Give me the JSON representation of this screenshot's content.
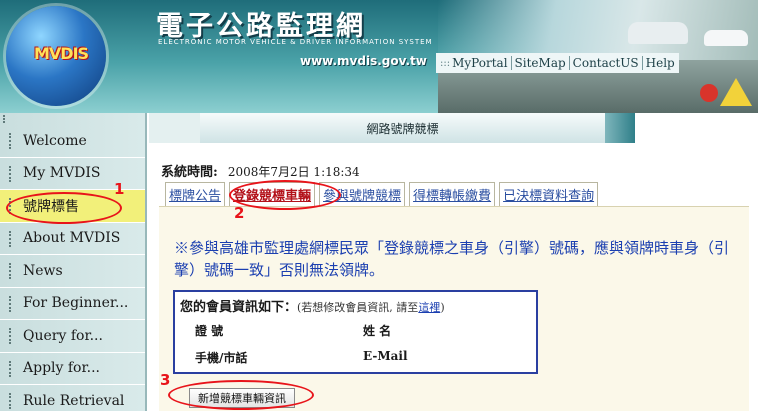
{
  "header": {
    "logo_text": "MVDIS",
    "site_title": "電子公路監理網",
    "site_subtitle": "ELECTRONIC MOTOR VEHICLE & DRIVER INFORMATION SYSTEM",
    "url": "www.mvdis.gov.tw",
    "nav_prefix": ":::",
    "nav": [
      "MyPortal",
      "SiteMap",
      "ContactUS",
      "Help"
    ]
  },
  "sidebar": {
    "items": [
      {
        "label": "Welcome"
      },
      {
        "label": "My MVDIS"
      },
      {
        "label": "號牌標售"
      },
      {
        "label": "About MVDIS"
      },
      {
        "label": "News"
      },
      {
        "label": "For Beginner..."
      },
      {
        "label": "Query for..."
      },
      {
        "label": "Apply for..."
      },
      {
        "label": "Rule Retrieval"
      }
    ],
    "active_index": 2
  },
  "content": {
    "banner_title": "網路號牌競標",
    "systime_label": "系統時間:",
    "systime_value": "2008年7月2日 1:18:34",
    "tabs": [
      {
        "label": "標牌公告"
      },
      {
        "label": "登錄競標車輛"
      },
      {
        "label": "參與號牌競標"
      },
      {
        "label": "得標轉帳繳費"
      },
      {
        "label": "已決標資料查詢"
      }
    ],
    "active_tab": 1,
    "notice_mark": "※",
    "notice_text": "參與高雄市監理處網標民眾「登錄競標之車身（引擎）號碼，應與領牌時車身（引擎）號碼一致」否則無法領牌。",
    "member": {
      "title": "您的會員資訊如下：",
      "note_prefix": "(若想修改會員資訊, 請至",
      "note_link": "這裡",
      "note_suffix": ")",
      "fields": {
        "id": "證 號",
        "name": "姓 名",
        "phone": "手機/市話",
        "email": "E-Mail"
      }
    },
    "add_button": "新增競標車輛資訊"
  },
  "annotations": [
    "1",
    "2",
    "3"
  ],
  "colors": {
    "annotation_red": "#e8141a",
    "active_sidebar_bg": "#f2f07a",
    "tab_link": "#2a4ea0",
    "notice_red": "#b3121a"
  }
}
